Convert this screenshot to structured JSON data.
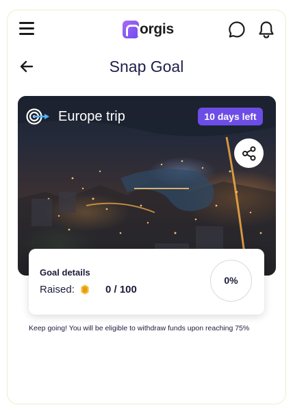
{
  "app": {
    "logo_letter": "M",
    "logo_text": "orgis",
    "brand_color": "#6c4bf0"
  },
  "header": {
    "menu_icon": "hamburger-menu-icon",
    "chat_icon": "chat-bubble-icon",
    "notification_icon": "bell-icon"
  },
  "page": {
    "title": "Snap Goal",
    "back_icon": "arrow-left-icon"
  },
  "goal": {
    "name": "Europe trip",
    "goal_icon": "target-arrow-icon",
    "days_left": "10 days left",
    "share_icon": "share-icon",
    "badge_color": "#6c4de6"
  },
  "details": {
    "heading": "Goal details",
    "raised_label": "Raised:",
    "coin_icon": "coin-icon",
    "raised_value": "0 / 100",
    "progress_text": "0%",
    "progress": 0
  },
  "hint": "Keep going! You will be eligible to withdraw funds upon reaching 75%"
}
